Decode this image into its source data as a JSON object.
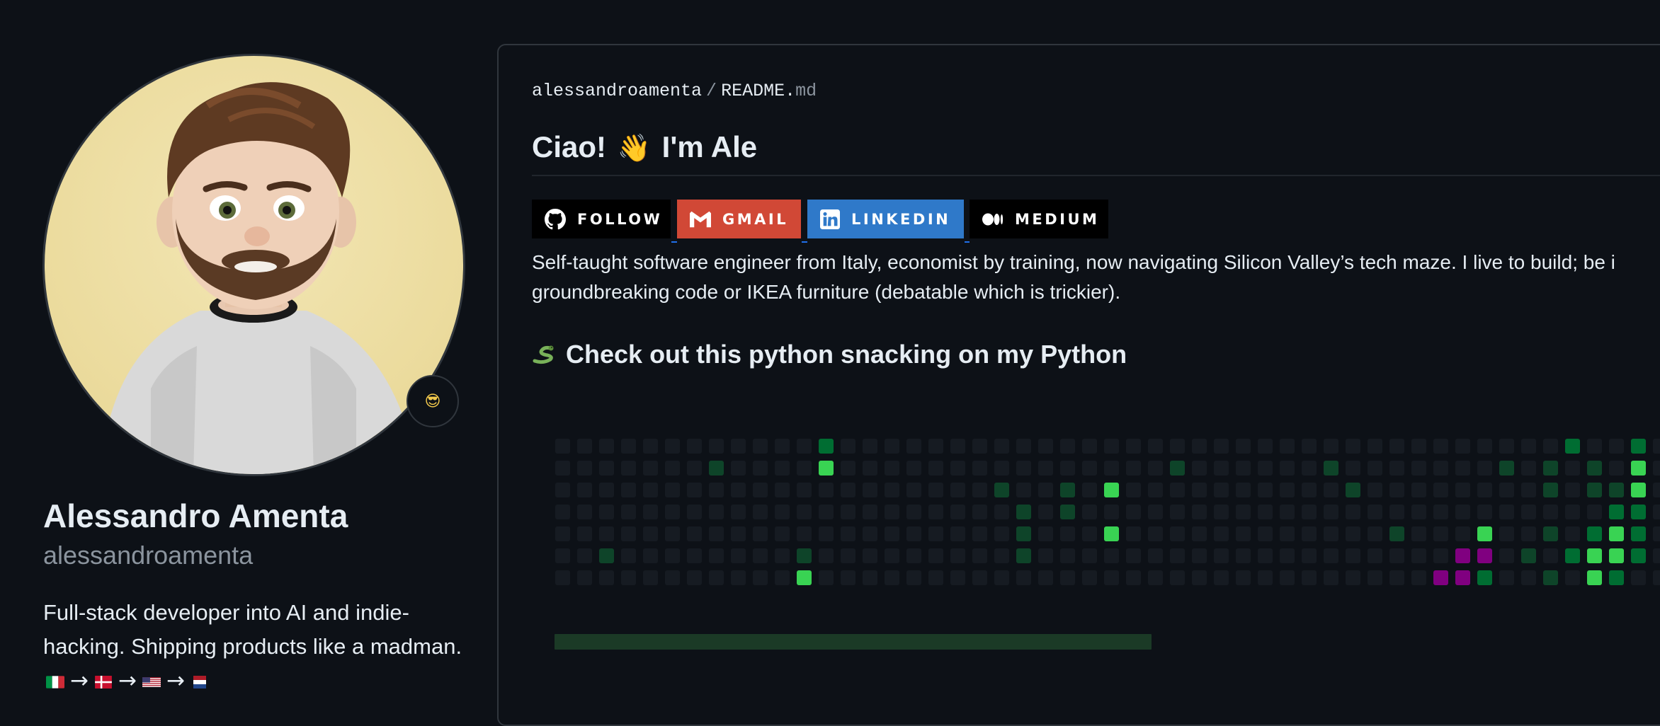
{
  "profile": {
    "full_name": "Alessandro Amenta",
    "login": "alessandroamenta",
    "bio": "Full-stack developer into AI and indie-hacking. Shipping products like a madman.",
    "status_icon": "sunglasses-face-icon",
    "status_emoji": "😎",
    "flags": [
      "italy-flag-icon",
      "denmark-flag-icon",
      "usa-flag-icon",
      "netherlands-flag-icon"
    ],
    "arrow": "→"
  },
  "readme": {
    "path_owner": "alessandroamenta",
    "path_separator": "/",
    "path_file": "README.",
    "path_ext": "md",
    "greeting_pre": "Ciao!",
    "greeting_emoji": "👋",
    "greeting_post": "I'm Ale",
    "badges": [
      {
        "label": "FOLLOW",
        "icon": "github-icon",
        "color": "#000000"
      },
      {
        "label": "GMAIL",
        "icon": "gmail-icon",
        "color": "#d14836"
      },
      {
        "label": "LINKEDIN",
        "icon": "linkedin-icon",
        "color": "#0077b5"
      },
      {
        "label": "MEDIUM",
        "icon": "medium-icon",
        "color": "#000000"
      }
    ],
    "intro_line1": "Self-taught software engineer from Italy, economist by training, now navigating Silicon Valley’s tech maze. I live to build; be i",
    "intro_line2": "groundbreaking code or IKEA furniture (debatable which is trickier).",
    "snake_heading": "Check out this python snacking on my Python",
    "snake_icon": "snake-icon"
  },
  "contribution_graph": {
    "colors": {
      "empty": "#161b22",
      "l1": "#0e4429",
      "l2": "#006d32",
      "l3": "#26a641",
      "l4": "#39d353",
      "snake": "#800080"
    },
    "progress_fraction": 0.35
  }
}
